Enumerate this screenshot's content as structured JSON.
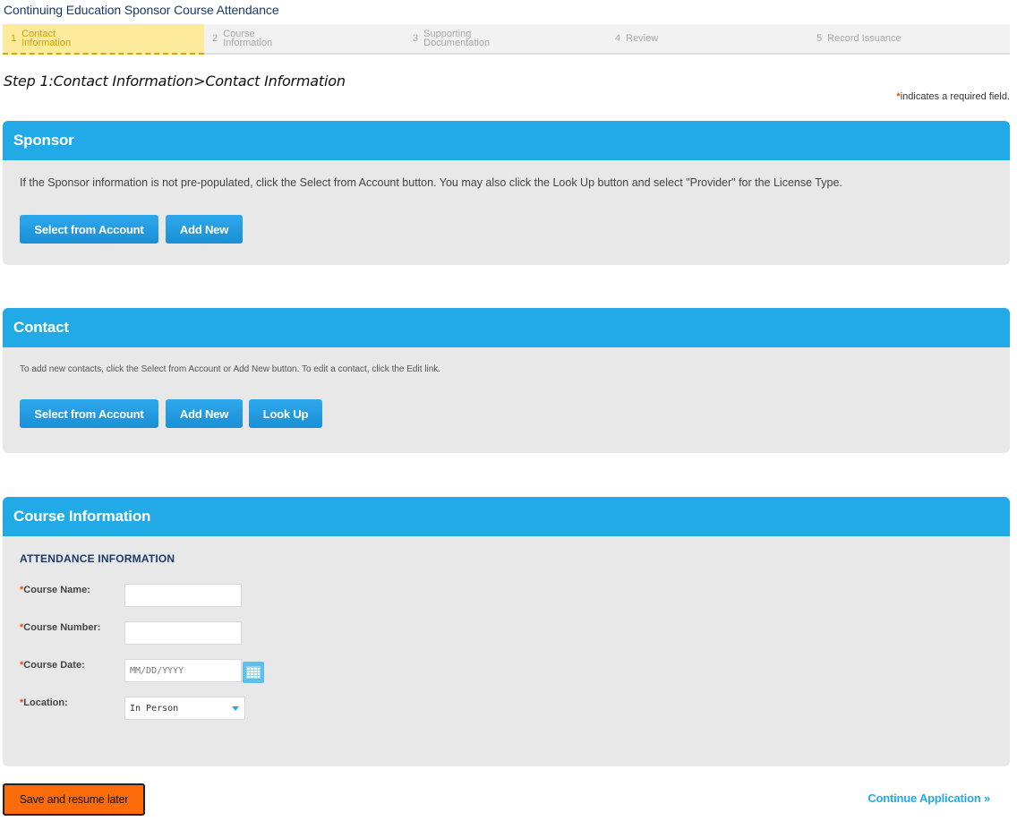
{
  "page": {
    "title": "Continuing Education Sponsor Course Attendance"
  },
  "steps": [
    {
      "num": "1",
      "label": "Contact Information",
      "active": true
    },
    {
      "num": "2",
      "label": "Course Information",
      "active": false
    },
    {
      "num": "3",
      "label": "Supporting Documentation",
      "active": false
    },
    {
      "num": "4",
      "label": "Review",
      "active": false
    },
    {
      "num": "5",
      "label": "Record Issuance",
      "active": false
    }
  ],
  "step_heading": "Step 1:Contact Information>Contact Information",
  "required_note": {
    "marker": "*",
    "text": "indicates a required field."
  },
  "sponsor": {
    "title": "Sponsor",
    "instructions": "If the Sponsor information is not pre-populated, click the Select from Account button. You may also click the Look Up button and select \"Provider\" for the License Type.",
    "select_label": "Select from Account",
    "add_label": "Add New"
  },
  "contact": {
    "title": "Contact",
    "instructions": "To add new contacts, click the Select from Account or Add New button. To edit a contact, click the Edit link.",
    "select_label": "Select from Account",
    "add_label": "Add New",
    "lookup_label": "Look Up"
  },
  "course": {
    "title": "Course Information",
    "subheading": "ATTENDANCE INFORMATION",
    "fields": {
      "name": {
        "label": "Course Name:",
        "value": ""
      },
      "number": {
        "label": "Course Number:",
        "value": ""
      },
      "date": {
        "label": "Course Date:",
        "placeholder": "MM/DD/YYYY"
      },
      "location": {
        "label": "Location:",
        "selected": "In Person"
      }
    }
  },
  "footer": {
    "save_label": "Save and resume later",
    "continue_label": "Continue Application »"
  },
  "colors": {
    "header_blue": "#22aae8",
    "save_orange": "#fc6c0b",
    "active_step": "#fdea9b"
  }
}
